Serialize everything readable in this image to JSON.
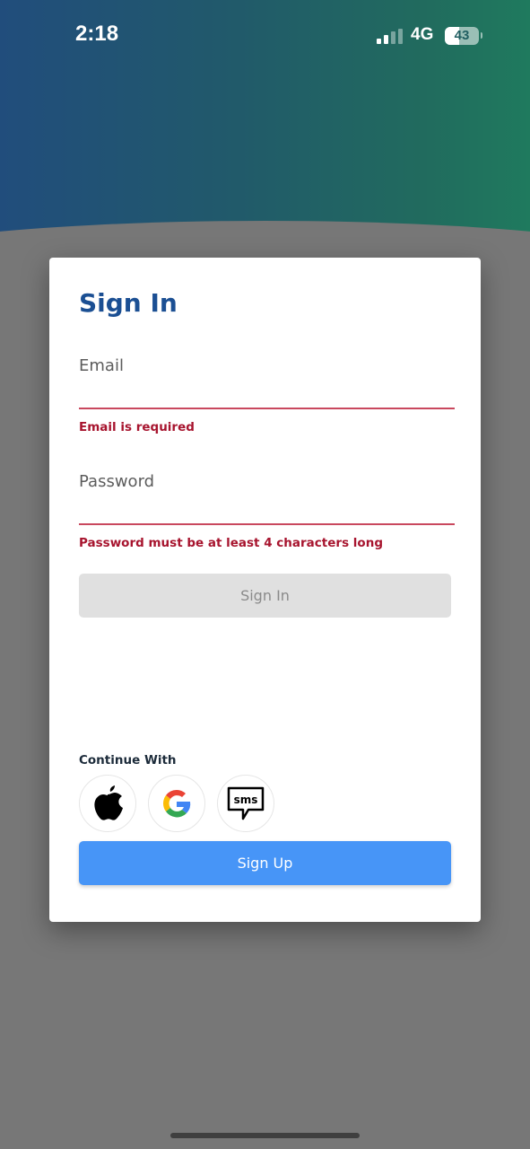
{
  "status_bar": {
    "time": "2:18",
    "network": "4G",
    "signal_bars_active": 2,
    "signal_bars_total": 4,
    "battery_percent": "43"
  },
  "sign_in": {
    "title": "Sign In",
    "email": {
      "label": "Email",
      "value": "",
      "error": "Email is required"
    },
    "password": {
      "label": "Password",
      "value": "",
      "error": "Password must be at least 4 characters long"
    },
    "sign_in_button": "Sign In",
    "continue_with_label": "Continue With",
    "social_providers": [
      {
        "name": "Apple",
        "icon": "apple-icon"
      },
      {
        "name": "Google",
        "icon": "google-icon"
      },
      {
        "name": "SMS",
        "icon": "sms-icon",
        "text": "sms"
      }
    ],
    "sign_up_button": "Sign Up"
  },
  "colors": {
    "title": "#1b4f93",
    "error": "#a7142e",
    "error_underline": "#c9485e",
    "sign_up": "#4795f7",
    "sign_in_disabled": "#e0e0e0",
    "header_gradient_start": "#214d7c",
    "header_gradient_end": "#1f7a5e",
    "backdrop": "#777777"
  }
}
